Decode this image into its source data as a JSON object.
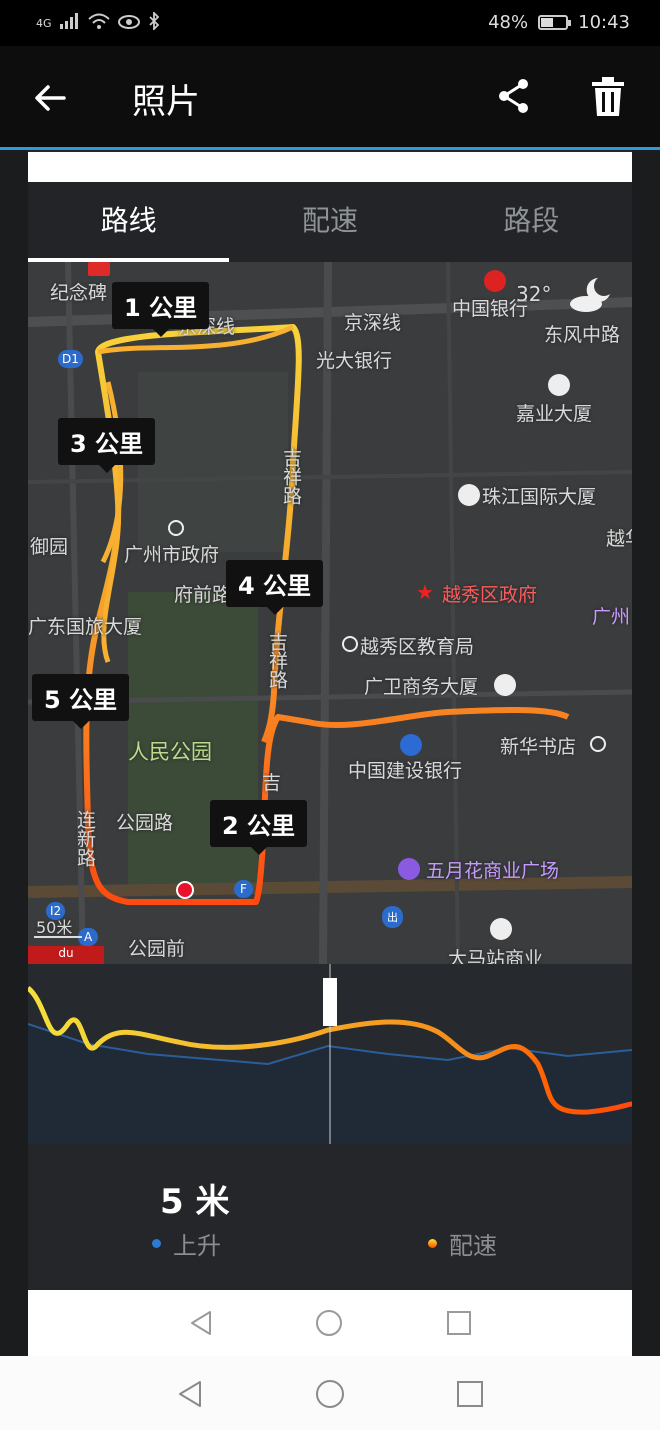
{
  "status_bar": {
    "network": "4G",
    "battery": "48%",
    "time": "10:43"
  },
  "app_bar": {
    "title": "照片"
  },
  "tabs": [
    {
      "label": "路线",
      "active": true
    },
    {
      "label": "配速",
      "active": false
    },
    {
      "label": "路段",
      "active": false
    }
  ],
  "map": {
    "weather_temp": "32°",
    "scale": "50米",
    "km_markers": [
      "1 公里",
      "2 公里",
      "3 公里",
      "4 公里",
      "5 公里"
    ],
    "labels": {
      "jinianbei": "纪念碑",
      "jingshenxian_1": "京深线",
      "jingshenxian_2": "京深线",
      "bank_china": "中国银行",
      "dongfeng": "东风中路",
      "everbright": "光大银行",
      "jiaye": "嘉业大厦",
      "jixiang_1": "吉祥路",
      "jixiang_2": "吉祥路",
      "jixiang_3": "吉",
      "zhujiang": "珠江国际大厦",
      "gz_gov": "广州市政府",
      "fuqian": "府前路",
      "yuexiu_gov": "越秀区政府",
      "yue": "越华",
      "yuexiu_edu": "越秀区教育局",
      "guangzhou_r": "广州",
      "guangwei": "广卫商务大厦",
      "lvyou": "广东国旅大厦",
      "people_park": "人民公园",
      "ccb": "中国建设银行",
      "xinhua": "新华书店",
      "gongyuanlu": "公园路",
      "lianxinlu": "连新路",
      "wuyuehua": "五月花商业广场",
      "gongyuanqian": "公园前",
      "damazhan": "大马站商业",
      "yuan": "御园",
      "d1": "D1",
      "i2": "I2",
      "a": "A",
      "f": "F",
      "du": "du",
      "chu": "出"
    }
  },
  "stats": {
    "value": "5 米",
    "legend_ascent": "上升",
    "legend_pace": "配速"
  },
  "colors": {
    "accent": "#2a9be0",
    "route_start": "#f7e437",
    "route_end": "#ff4a00",
    "ascent_dot": "#2a7bd6"
  },
  "icons": [
    "back-arrow-icon",
    "share-icon",
    "trash-icon",
    "moon-cloud-icon",
    "bank-icon",
    "star-icon",
    "nav-back-icon",
    "nav-home-icon",
    "nav-recent-icon"
  ]
}
